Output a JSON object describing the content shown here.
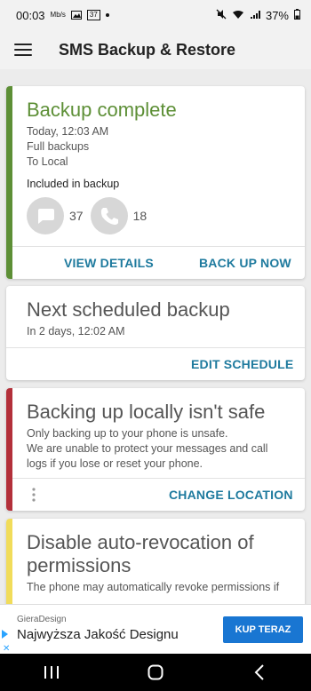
{
  "status": {
    "time": "00:03",
    "battery": "37%",
    "small_text": "Mb/s",
    "notif_badge": "37"
  },
  "app": {
    "title": "SMS Backup & Restore"
  },
  "card_backup": {
    "title": "Backup complete",
    "time": "Today, 12:03 AM",
    "type": "Full backups",
    "destination": "To Local",
    "included_label": "Included in backup",
    "messages_count": "37",
    "calls_count": "18",
    "view_details": "VIEW DETAILS",
    "back_up_now": "BACK UP NOW",
    "accent": "#5d8f36"
  },
  "card_schedule": {
    "title": "Next scheduled backup",
    "subtitle": "In 2 days, 12:02 AM",
    "edit": "EDIT SCHEDULE"
  },
  "card_warning": {
    "title": "Backing up locally isn't safe",
    "line1": "Only backing up to your phone is unsafe.",
    "line2": "We are unable to protect your messages and call logs if you lose or reset your phone.",
    "change": "CHANGE LOCATION",
    "accent": "#b3303a"
  },
  "card_permissions": {
    "title": "Disable auto-revocation of permissions",
    "line1": "The phone may automatically revoke permissions if",
    "accent": "#f1dc5a"
  },
  "ad": {
    "brand": "GieraDesign",
    "headline": "Najwyższa Jakość Designu",
    "cta": "KUP TERAZ"
  }
}
